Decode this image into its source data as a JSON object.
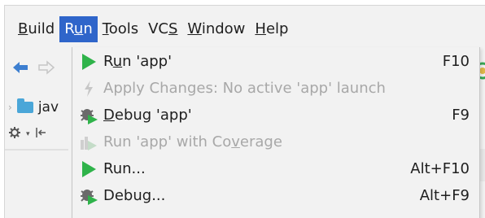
{
  "menubar": {
    "items": [
      {
        "label": "Build",
        "mnemonic": "B",
        "rest": "uild"
      },
      {
        "label": "Run",
        "pre": "R",
        "mnemonic": "u",
        "rest": "n"
      },
      {
        "label": "Tools",
        "mnemonic": "T",
        "rest": "ools"
      },
      {
        "label": "VCS",
        "pre": "VC",
        "mnemonic": "S",
        "rest": ""
      },
      {
        "label": "Window",
        "mnemonic": "W",
        "rest": "indow"
      },
      {
        "label": "Help",
        "mnemonic": "H",
        "rest": "elp"
      }
    ],
    "active": "Run"
  },
  "sidebar": {
    "project_label": "jav"
  },
  "run_menu": {
    "items": [
      {
        "pre": "R",
        "mn": "u",
        "post": "n 'app'",
        "shortcut": "F10",
        "icon": "run-icon",
        "enabled": true
      },
      {
        "pre": "",
        "mn": "",
        "post": "Apply Changes: No active 'app' launch",
        "shortcut": "",
        "icon": "apply-changes-icon",
        "enabled": false
      },
      {
        "pre": "",
        "mn": "D",
        "post": "ebug 'app'",
        "shortcut": "F9",
        "icon": "debug-icon",
        "enabled": true
      },
      {
        "pre": "Run 'app' with Co",
        "mn": "v",
        "post": "erage",
        "shortcut": "",
        "icon": "coverage-icon",
        "enabled": false
      },
      {
        "pre": "Run...",
        "mn": "",
        "post": "",
        "shortcut": "Alt+F10",
        "icon": "run-icon",
        "enabled": true
      },
      {
        "pre": "Debug...",
        "mn": "",
        "post": "",
        "shortcut": "Alt+F9",
        "icon": "debug-icon",
        "enabled": true
      }
    ]
  },
  "colors": {
    "menu_active_bg": "#2f65ca",
    "run_green": "#2fb34a",
    "back_arrow_blue": "#3d7fd0"
  }
}
